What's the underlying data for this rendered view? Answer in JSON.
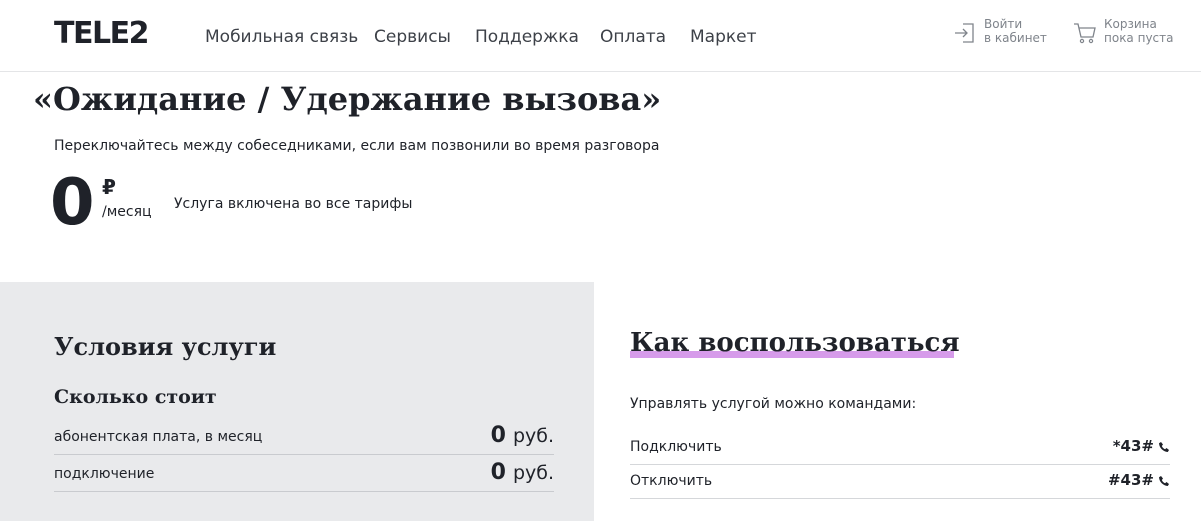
{
  "header": {
    "logo": "TELE2",
    "nav": [
      "Мобильная связь",
      "Сервисы",
      "Поддержка",
      "Оплата",
      "Маркет"
    ],
    "login": "Войти\nв кабинет",
    "cart": "Корзина\nпока пуста",
    "login_icon": "login-arrow-icon",
    "cart_icon": "cart-icon"
  },
  "service": {
    "title": "«Ожидание / Удержание вызова»",
    "subtitle": "Переключайтесь между собеседниками, если вам позвонили во время разговора",
    "price": "0",
    "currency": "₽",
    "period": "/месяц",
    "note": "Услуга включена во все тарифы"
  },
  "conditions": {
    "title": "Условия услуги",
    "subtitle": "Сколько стоит",
    "rows": [
      {
        "label": "абонентская плата, в месяц",
        "amount": "0",
        "unit": "руб."
      },
      {
        "label": "подключение",
        "amount": "0",
        "unit": "руб."
      }
    ]
  },
  "how_to": {
    "title": "Как воспользоваться",
    "intro": "Управлять услугой можно командами:",
    "rows": [
      {
        "label": "Подключить",
        "command": "*43#"
      },
      {
        "label": "Отключить",
        "command": "#43#"
      }
    ],
    "accent_color": "#c879e3"
  }
}
